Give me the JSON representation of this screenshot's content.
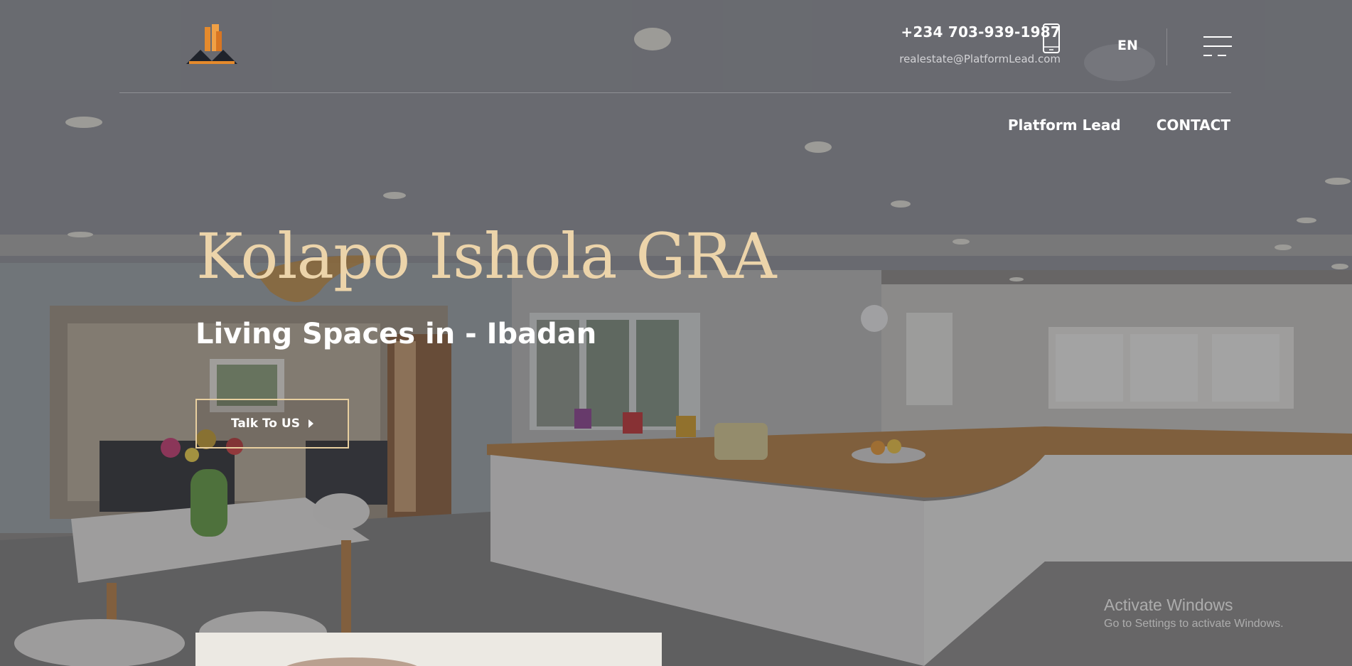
{
  "header": {
    "phone": "+234 703-939-1987",
    "email": "realestate@PlatformLead.com",
    "language": "EN"
  },
  "nav": {
    "items": [
      "Platform Lead",
      "CONTACT"
    ]
  },
  "hero": {
    "title": "Kolapo Ishola GRA",
    "subtitle": "Living Spaces in - Ibadan",
    "cta_label": "Talk To US"
  },
  "watermark": {
    "title": "Activate Windows",
    "subtitle": "Go to Settings to activate Windows."
  },
  "icons": {
    "phone": "mobile-phone-icon",
    "menu": "hamburger-menu-icon",
    "cta_arrow": "caret-right-icon"
  },
  "colors": {
    "title_gold": "#ecd4aa",
    "cta_border": "#e8cf9f",
    "logo_orange": "#e58a2c"
  }
}
